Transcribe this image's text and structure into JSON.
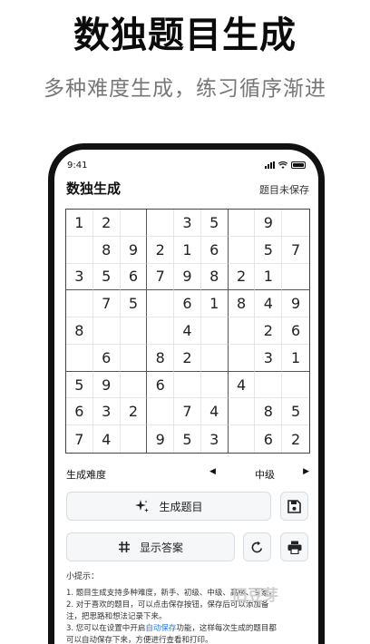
{
  "hero": {
    "title": "数独题目生成",
    "subtitle": "多种难度生成，练习循序渐进"
  },
  "status_bar": {
    "time": "9:41"
  },
  "app": {
    "title": "数独生成",
    "save_status": "题目未保存"
  },
  "sudoku": {
    "rows": [
      [
        "1",
        "2",
        "",
        "",
        "3",
        "5",
        "",
        "9",
        ""
      ],
      [
        "",
        "8",
        "9",
        "2",
        "1",
        "6",
        "",
        "5",
        "7"
      ],
      [
        "3",
        "5",
        "6",
        "7",
        "9",
        "8",
        "2",
        "1",
        ""
      ],
      [
        "",
        "7",
        "5",
        "",
        "6",
        "1",
        "8",
        "4",
        "9"
      ],
      [
        "8",
        "",
        "",
        "",
        "4",
        "",
        "",
        "2",
        "6"
      ],
      [
        "",
        "6",
        "",
        "8",
        "2",
        "",
        "",
        "3",
        "1"
      ],
      [
        "5",
        "9",
        "",
        "6",
        "",
        "",
        "4",
        "",
        ""
      ],
      [
        "6",
        "3",
        "2",
        "",
        "7",
        "4",
        "",
        "8",
        "5"
      ],
      [
        "7",
        "4",
        "",
        "9",
        "5",
        "3",
        "",
        "6",
        "2"
      ]
    ]
  },
  "difficulty": {
    "label": "生成难度",
    "prev_icon": "◀",
    "value": "中级",
    "next_icon": "▶"
  },
  "buttons": {
    "generate_label": "生成题目",
    "generate_icon": "sparkle-icon",
    "save_icon": "save-icon",
    "answer_label": "显示答案",
    "answer_icon": "hash-icon",
    "reset_icon": "refresh-icon",
    "print_icon": "print-icon"
  },
  "tips": {
    "heading": "小提示：",
    "line1": "1. 题目生成支持多种难度，新手、初级、中级、高级、专家。",
    "line2a": "2. 对于喜欢的题目，可以点击保存按钮，保存后可以添加备",
    "line2b": "注，把思路和想法记录下来。",
    "line3a_pre": "3. 您可以在设置中开启",
    "line3a_link": "自动保存",
    "line3a_post": "功能，这样每次生成的题目都",
    "line3b": "可以自动保存下来，方便进行查看和打印。"
  },
  "watermark": "旧豆芽",
  "colors": {
    "link": "#2a79d6",
    "frame": "#111111"
  }
}
